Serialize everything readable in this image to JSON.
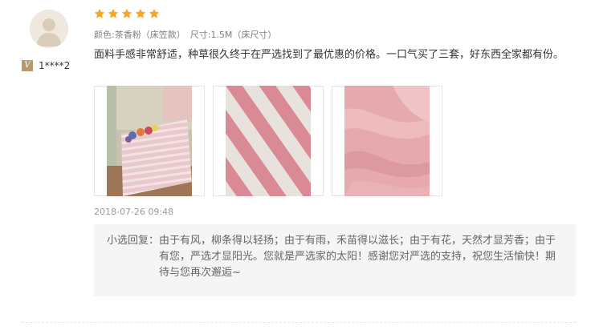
{
  "user": {
    "avatar_icon": "user-avatar-icon",
    "badge_text": "V",
    "username": "1****2"
  },
  "rating": {
    "stars": 5,
    "max": 5,
    "star_color": "#f5a623"
  },
  "sku": {
    "color": "颜色:茶香粉（床笠款）",
    "size": "尺寸:1.5M（床尺寸）"
  },
  "review": {
    "text": "面料手感非常舒适，种草很久终于在严选找到了最优惠的价格。一口气买了三套，好东西全家都有份。"
  },
  "photos": [
    {
      "name": "photo-bed"
    },
    {
      "name": "photo-stripe-fabric"
    },
    {
      "name": "photo-fabric-closeup"
    }
  ],
  "date": "2018-07-26 09:48",
  "reply": {
    "label": "小选回复：",
    "text": "由于有风，柳条得以轻扬；由于有雨，禾苗得以滋长；由于有花，天然才显芳香；由于有您，严选才显阳光。您就是严选家的太阳！感谢您对严选的支持，祝您生活愉快！期待与您再次邂逅~"
  }
}
